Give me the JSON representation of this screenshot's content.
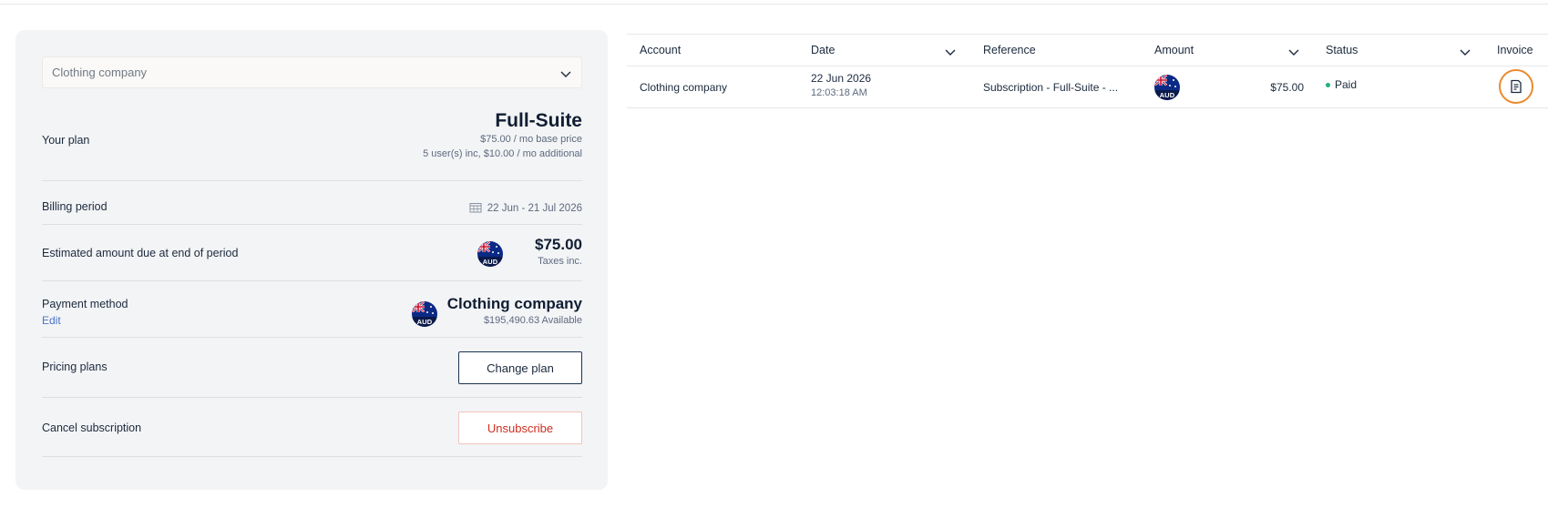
{
  "billing": {
    "account_select": {
      "value": "Clothing company"
    },
    "plan": {
      "label": "Your plan",
      "name": "Full-Suite",
      "base_price": "$75.00 / mo base price",
      "users_info": "5 user(s) inc, $10.00 / mo additional"
    },
    "billing_period": {
      "label": "Billing period",
      "value": "22 Jun - 21 Jul 2026"
    },
    "estimated": {
      "label": "Estimated amount due at end of period",
      "currency": "AUD",
      "amount": "$75.00",
      "note": "Taxes inc."
    },
    "payment_method": {
      "label": "Payment method",
      "edit_label": "Edit",
      "currency": "AUD",
      "name": "Clothing company",
      "available": "$195,490.63 Available"
    },
    "pricing_plans": {
      "label": "Pricing plans",
      "button": "Change plan"
    },
    "cancel": {
      "label": "Cancel subscription",
      "button": "Unsubscribe"
    }
  },
  "table": {
    "headers": {
      "account": "Account",
      "date": "Date",
      "reference": "Reference",
      "amount": "Amount",
      "status": "Status",
      "invoice": "Invoice"
    },
    "rows": [
      {
        "account": "Clothing company",
        "date": "22 Jun 2026",
        "time": "12:03:18 AM",
        "reference": "Subscription - Full-Suite - ...",
        "currency": "AUD",
        "amount": "$75.00",
        "status": "Paid"
      }
    ]
  },
  "colors": {
    "panel_bg": "#f3f4f6",
    "link": "#4a73c7",
    "danger": "#cf2e20",
    "status_paid": "#22b07d",
    "highlight": "#ea8a2f"
  }
}
